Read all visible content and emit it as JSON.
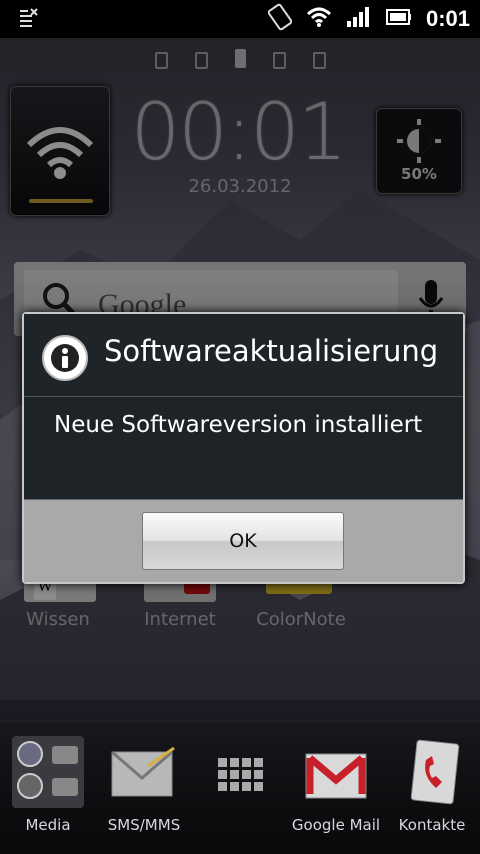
{
  "status_bar": {
    "time": "0:01"
  },
  "home": {
    "clock": "00:01",
    "date": "26.03.2012",
    "brightness": "50%",
    "search_widget": {
      "text": "Google"
    },
    "apps": [
      {
        "label": "Wissen"
      },
      {
        "label": "Internet"
      },
      {
        "label": "ColorNote"
      }
    ],
    "dock": [
      {
        "label": "Media",
        "icon": "media-icon"
      },
      {
        "label": "SMS/MMS",
        "icon": "envelope-icon"
      },
      {
        "label": "",
        "icon": "app-grid-icon"
      },
      {
        "label": "Google Mail",
        "icon": "gmail-icon"
      },
      {
        "label": "Kontakte",
        "icon": "contacts-icon"
      }
    ]
  },
  "dialog": {
    "title": "Softwareaktualisierung",
    "message": "Neue Softwareversion installiert",
    "ok_label": "OK"
  }
}
